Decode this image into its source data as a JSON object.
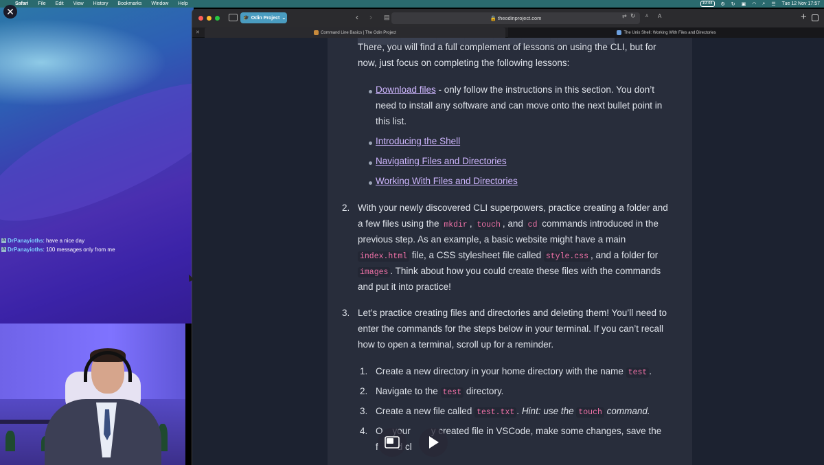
{
  "menubar": {
    "app_name": "Safari",
    "menus": [
      "File",
      "Edit",
      "View",
      "History",
      "Bookmarks",
      "Window",
      "Help"
    ],
    "battery": "19:44",
    "date_time": "Tue 12 Nov  17:57"
  },
  "chat": {
    "messages": [
      {
        "user": "DrPanayioths",
        "text": ": have a nice day"
      },
      {
        "user": "DrPanayioths",
        "text": ": 100 messages only from me"
      }
    ]
  },
  "browser": {
    "tab_group": "Odin Project",
    "url": "theodinproject.com",
    "font_small": "A",
    "font_large": "A",
    "tabs": [
      {
        "title": "Command Line Basics | The Odin Project",
        "active": true
      },
      {
        "title": "The Unix Shell: Working With Files and Directories",
        "active": false
      }
    ]
  },
  "article": {
    "top_line": "There, you will find a full complement of lessons on using the CLI, but for",
    "top_line2": "now, just focus on completing the following lessons:",
    "bullets": [
      {
        "link": "Download files",
        "text": " - only follow the instructions in this section. You don’t",
        "cont": [
          "need to install any software and can move onto the next bullet point in",
          "this list."
        ]
      },
      {
        "link": "Introducing the Shell"
      },
      {
        "link": "Navigating Files and Directories"
      },
      {
        "link": "Working With Files and Directories"
      }
    ],
    "item2": {
      "number": "2.",
      "l1": "With your newly discovered CLI superpowers, practice creating a folder and",
      "l2a": "a few files using the ",
      "code_mkdir": "mkdir",
      "l2b": ",",
      "code_touch": "touch",
      "l2c": ", and ",
      "code_cd": "cd",
      "l2d": " commands introduced in the",
      "l3": "previous step. As an example, a basic website might have a main",
      "code_index": "index.html",
      "l4a": " file, a CSS stylesheet file called ",
      "code_style": "style.css",
      "l4b": ", and a folder for",
      "code_images": "images",
      "l5": ". Think about how you could create these files with the commands",
      "l6": "and put it into practice!"
    },
    "item3": {
      "number": "3.",
      "l1": "Let’s practice creating files and directories and deleting them! You’ll need to",
      "l2": "enter the commands for the steps below in your terminal. If you can’t recall",
      "l3": "how to open a terminal, scroll up for a reminder."
    },
    "subitems": [
      {
        "number": "1.",
        "a": "Create a new directory in your home directory with the name ",
        "code": "test",
        "b": "."
      },
      {
        "number": "2.",
        "a": "Navigate to the ",
        "code": "test",
        "b": " directory."
      },
      {
        "number": "3.",
        "a": "Create a new file called ",
        "code": "test.txt",
        "b": ". ",
        "hint_a": "Hint: use the ",
        "hint_code": "touch",
        "hint_b": " command."
      },
      {
        "number": "4.",
        "a": "O",
        "b": "your",
        "c": "y created file in VSCode, make some changes, save the",
        "d": "f",
        "e": "d cl"
      }
    ]
  },
  "colors": {
    "accent_link": "#cfb7ff",
    "code_text": "#f072a8",
    "tab_group": "#4a9cc0"
  }
}
